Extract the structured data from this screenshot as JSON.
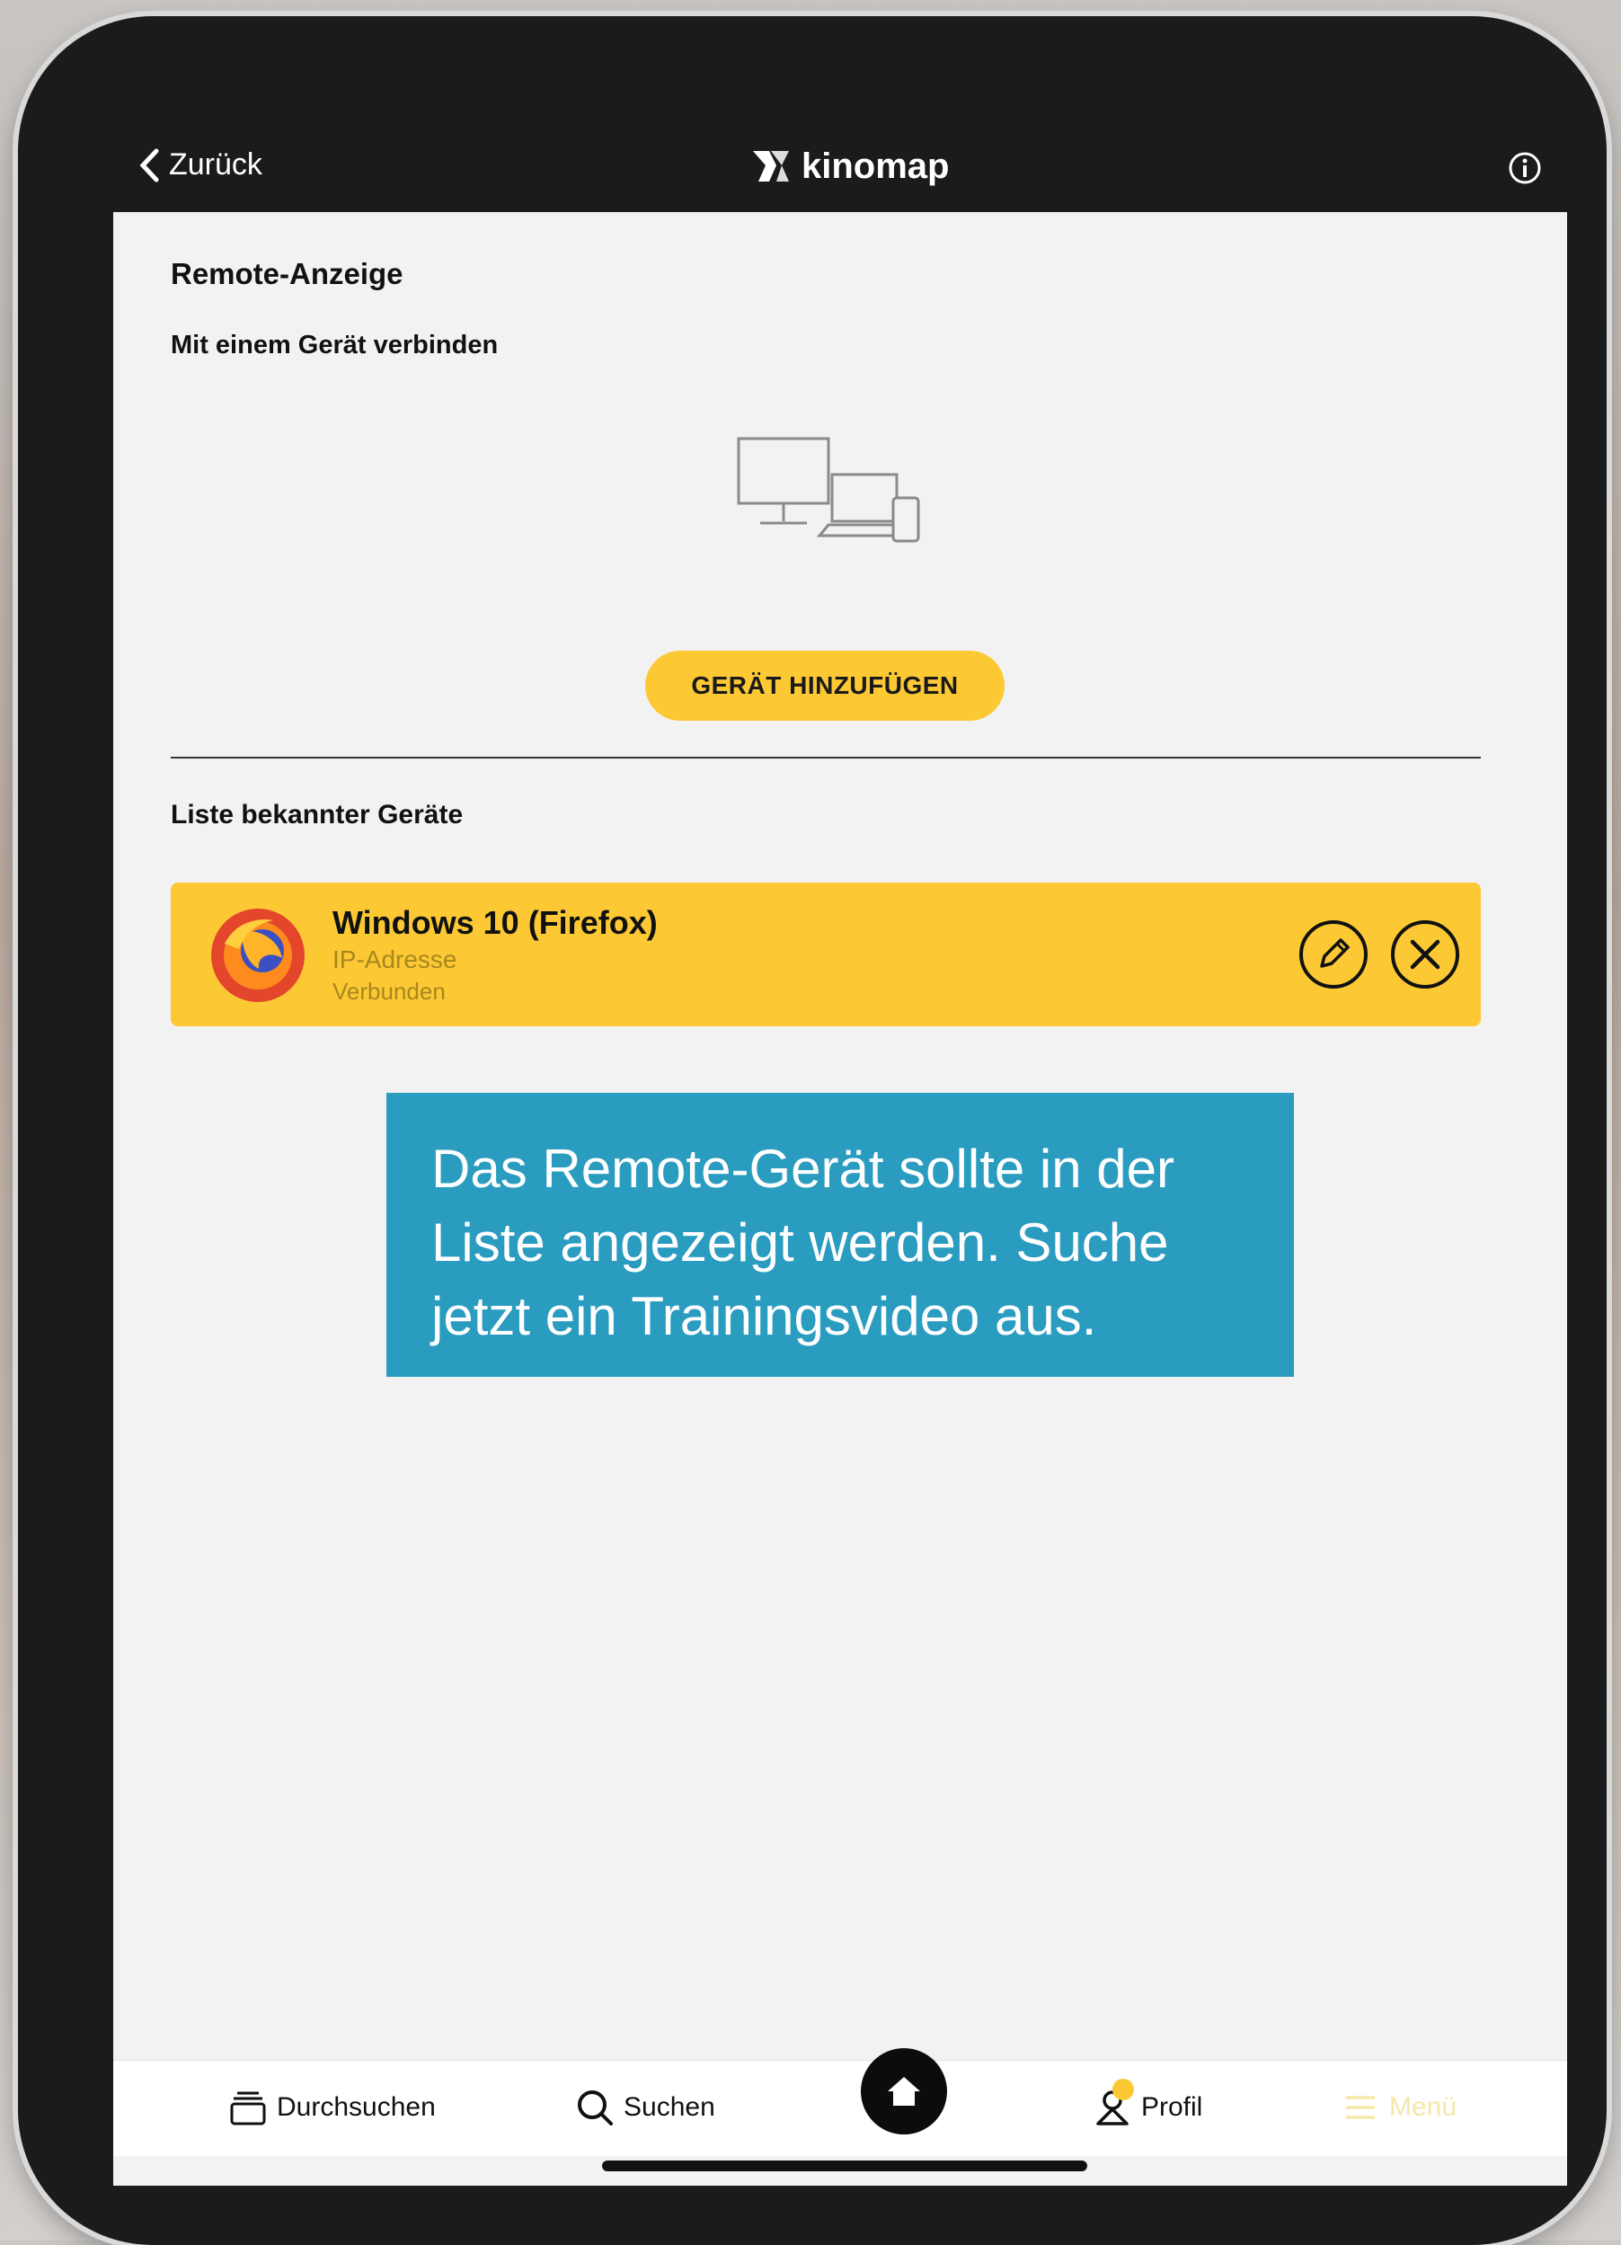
{
  "topbar": {
    "back_label": "Zurück",
    "brand": "kinomap"
  },
  "page": {
    "title": "Remote-Anzeige",
    "connect_subtitle": "Mit einem Gerät verbinden",
    "add_device_label": "GERÄT HINZUFÜGEN",
    "known_devices_title": "Liste bekannter Geräte"
  },
  "devices": [
    {
      "name": "Windows 10 (Firefox)",
      "ip_label": "IP-Adresse",
      "status": "Verbunden"
    }
  ],
  "overlay": {
    "text": "Das Remote-Gerät sollte in der Liste angezeigt werden. Suche jetzt ein Trainingsvideo aus."
  },
  "tabbar": {
    "browse": "Durchsuchen",
    "search": "Suchen",
    "profile": "Profil",
    "menu": "Menü"
  },
  "colors": {
    "accent": "#fcc935",
    "overlay": "#2a9cc0",
    "frame": "#1b1b1b"
  }
}
